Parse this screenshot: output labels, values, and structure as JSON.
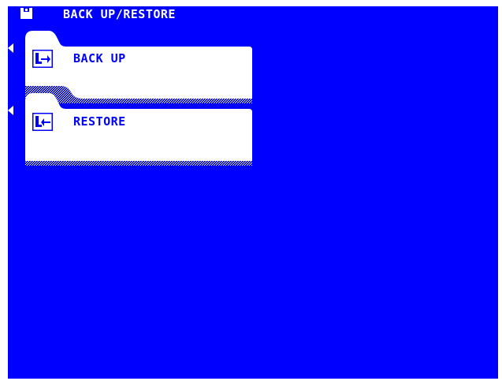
{
  "header": {
    "title": "BACK UP/RESTORE",
    "icon": "floppy-disk-icon"
  },
  "menu": {
    "items": [
      {
        "label": "BACK UP",
        "icon": "backup-arrow-icon",
        "selected": true
      },
      {
        "label": "RESTORE",
        "icon": "restore-arrow-icon",
        "selected": true
      }
    ]
  },
  "colors": {
    "background": "#0000ff",
    "foreground": "#ffffff"
  }
}
